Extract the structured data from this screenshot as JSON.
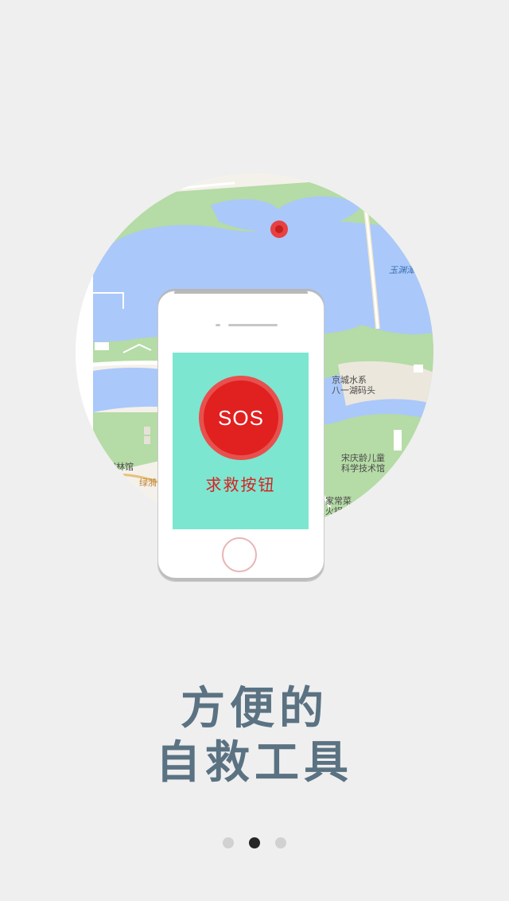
{
  "map": {
    "labels": {
      "water_name": "玉渊潭",
      "poi_1_line1": "京城水系",
      "poi_1_line2": "八一湖码头",
      "poi_2_line1": "宋庆龄儿童",
      "poi_2_line2": "科学技术馆",
      "poi_3_line1": "家常菜",
      "poi_3_line2": "火锅",
      "poi_4": "柳林馆",
      "road_1": "绿漪"
    },
    "colors": {
      "water": "#aac8fa",
      "park": "#b5dba6",
      "land": "#f4f1ea",
      "marker": "#e84141"
    }
  },
  "phone": {
    "sos_label": "SOS",
    "caption": "求救按钮",
    "screen_color": "#7de6d0",
    "button_color": "#e12020"
  },
  "headline": {
    "line1": "方便的",
    "line2": "自救工具"
  },
  "pager": {
    "total": 3,
    "active_index": 1
  }
}
